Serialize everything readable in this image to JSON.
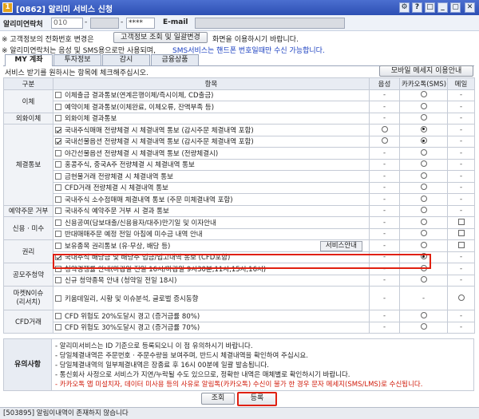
{
  "window": {
    "app_icon": "1",
    "title": "[0862] 알리미 서비스 신청",
    "controls": [
      "⚙",
      "?",
      "□",
      "_",
      "▢",
      "✕"
    ]
  },
  "account": {
    "label": "알리미연락처",
    "phone1": "010",
    "phone2": "",
    "phone3": "****",
    "email_label": "E-mail",
    "email_value": ""
  },
  "notices": {
    "line1_prefix": "※ 고객정보의 전화번호 변경은",
    "line1_button": "고객정보 조회 및 일괄변경",
    "line1_suffix": "화면을 이용하시기 바랍니다.",
    "line2_prefix": "※ 알리미연락처는 음성 및 SMS용으로만 사용되며,",
    "line2_highlight": "SMS서비스는 핸드폰 번호일때만 수신 가능합니다."
  },
  "tabs": [
    {
      "label": "MY 계좌",
      "active": true
    },
    {
      "label": "투자정보",
      "active": false
    },
    {
      "label": "감시",
      "active": false
    },
    {
      "label": "금융상품",
      "active": false
    }
  ],
  "instruction": "서비스 받기를 원하시는 항목에 체크해주십시오.",
  "mobile_msg_button": "모바일 메세지 이용안내",
  "table": {
    "headers": [
      "구분",
      "항목",
      "음성",
      "카카오톡(SMS)",
      "메일"
    ],
    "categories": {
      "transfer": "이체",
      "foreign_transfer": "외화이체",
      "execution": "체결통보",
      "reservation": "예약주문 거부",
      "credit": "신용 · 미수",
      "rights": "권리",
      "ipo": "공모주청약",
      "marketing": "마켓N이슈\n(리서치)",
      "cfd": "CFD거래"
    },
    "rows": {
      "r1": "이체출금 결과통보(연계은행이체/즉시이체, CD출금)",
      "r2": "예약이체 결과통보(이체완료, 이체오류, 잔액부족 등)",
      "r3": "외화이체 결과통보",
      "r4": "국내주식매매 전량체결 시 체결내역 통보 (감시주문 체결내역 포함)",
      "r5": "국내선물옵션 전량체결 시 체결내역 통보 (감시주문 체결내역 포함)",
      "r6": "야간선물옵션 전량체결 시 체결내역 통보 (전량체결시)",
      "r7": "홍콩주식, 중국A주 전량체결 시 체결내역 통보",
      "r8": "금현물거래 전량체결 시 체결내역 통보",
      "r9": "CFD거래 전량체결 시 체결내역 통보",
      "r10": "국내주식 소수점매매 체결내역 통보 (주문 미체결내역 포함)",
      "r11": "국내주식 예약주문 거부 시 결과 통보",
      "r12": "신용공여(담보대출/신용융자/대주)만기일 및 이자안내",
      "r13": "반대매매주문 예정 전일 아침에 미수금 내역 안내",
      "r14": "보유종목 권리통보 (유·무상, 배당 등)",
      "r14_button": "서비스안내",
      "r15": "국내주식 배당금 및 배당주 입금/입고내역 통보 (CFD포함)",
      "r16": "청약경쟁률 안내(마감일 전일 16시/마감일 9시30분,11시,15시,16시)",
      "r17": "신규 청약종목 안내 (청약일 전일 18시)",
      "r18": "키움데일리, 시황 및 이슈분석, 글로벌 증시동향",
      "r19": "CFD 위험도 20%도달시 경고 (증거금률 80%)",
      "r20": "CFD 위험도 30%도달시 경고 (증거금률 70%)"
    },
    "dash": "-"
  },
  "notes": {
    "head": "유의사항",
    "lines": [
      "- 알리미서비스는 ID 기준으로 등록되오니 이 점 유의하시기 바랍니다.",
      "- 당일체결내역은 주문번호 · 주문수량을 보여주며, 반드시 체결내역을 확인하여 주십시요.",
      "- 당일체결내역의 일부체결내역은 장종료 후 16시 00분에 일괄 발송됩니다.",
      "- 통신회사 사정으로 서비스가 지연/누락될 수도 있으므로, 정확한 내역은 매체별로 확인하시기 바랍니다.",
      "- 카카오톡 앱 미설치자, 데이터 미사용 등의 사유로 알림톡(카카오톡) 수신이 불가 한 경우 문자 메세지(SMS/LMS)로 수신됩니다."
    ]
  },
  "buttons": {
    "query": "조회",
    "register": "등록"
  },
  "status": "[503895] 알림이내역이 존재하지 않습니다",
  "colors": {
    "highlight_red": "#e02010",
    "sms_blue": "#1a3fc0",
    "title_blue": "#2d4fb3"
  }
}
